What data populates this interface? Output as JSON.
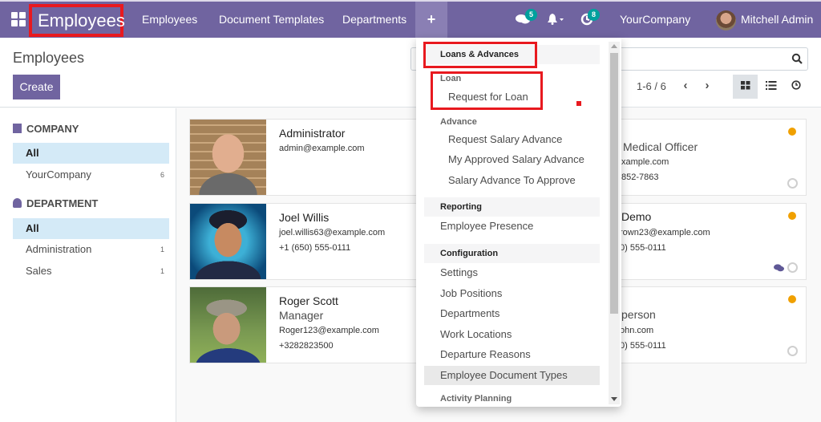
{
  "navbar": {
    "brand": "Employees",
    "menu": [
      "Employees",
      "Document Templates",
      "Departments"
    ],
    "plus": "+",
    "messages_badge": "5",
    "activities_badge": "8",
    "company": "YourCompany",
    "user": "Mitchell Admin"
  },
  "control": {
    "title": "Employees",
    "create_label": "Create",
    "search_placeholder": "",
    "pager": "1-6 / 6"
  },
  "sidebar": {
    "company_heading": "COMPANY",
    "company_items": [
      {
        "label": "All",
        "count": ""
      },
      {
        "label": "YourCompany",
        "count": "6"
      }
    ],
    "department_heading": "DEPARTMENT",
    "department_items": [
      {
        "label": "All",
        "count": ""
      },
      {
        "label": "Administration",
        "count": "1"
      },
      {
        "label": "Sales",
        "count": "1"
      }
    ]
  },
  "cards": [
    {
      "name": "Administrator",
      "job": "",
      "email": "admin@example.com",
      "phone": ""
    },
    {
      "name": "Joel Willis",
      "job": "",
      "email": "joel.willis63@example.com",
      "phone": "+1 (650) 555-0111"
    },
    {
      "name": "Roger Scott",
      "job": "Manager",
      "email": "Roger123@example.com",
      "phone": "+3282823500"
    }
  ],
  "right_cards": [
    {
      "name": "",
      "job": "Medical Officer",
      "email": "xample.com",
      "phone": "852-7863"
    },
    {
      "name": "Demo",
      "job": "",
      "email": "rown23@example.com",
      "phone": "0) 555-0111"
    },
    {
      "name": "",
      "job": "person",
      "email": "ohn.com",
      "phone": "0) 555-0111"
    }
  ],
  "dropdown": {
    "loans_header": "Loans & Advances",
    "loan_sub": "Loan",
    "request_loan": "Request for Loan",
    "advance_sub": "Advance",
    "advance_items": [
      "Request Salary Advance",
      "My Approved Salary Advance",
      "Salary Advance To Approve"
    ],
    "reporting_header": "Reporting",
    "reporting_items": [
      "Employee Presence"
    ],
    "configuration_header": "Configuration",
    "configuration_items": [
      "Settings",
      "Job Positions",
      "Departments",
      "Work Locations",
      "Departure Reasons",
      "Employee Document Types"
    ],
    "activity_header": "Activity Planning"
  },
  "colors": {
    "brand": "#7064a0",
    "highlight": "#e8191f",
    "badge": "#00a09d",
    "status_dot": "#f0a000"
  }
}
